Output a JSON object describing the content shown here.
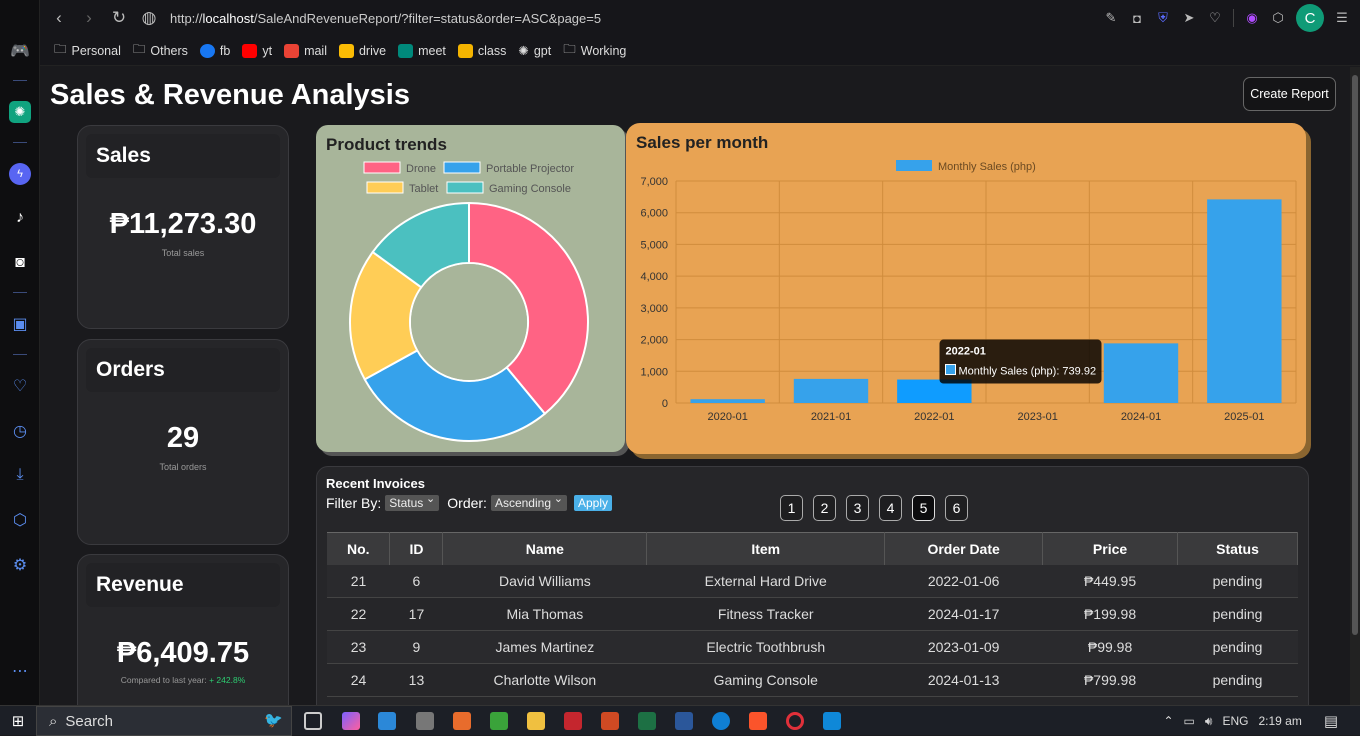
{
  "browser": {
    "url_prefix": "http://",
    "url_host": "localhost",
    "url_path": "/SaleAndRevenueReport/?filter=status&order=ASC&page=5",
    "avatar_letter": "C",
    "bookmarks": [
      "Personal",
      "Others",
      "fb",
      "yt",
      "mail",
      "drive",
      "meet",
      "class",
      "gpt",
      "Working"
    ]
  },
  "page": {
    "title": "Sales & Revenue Analysis",
    "create_report_label": "Create Report"
  },
  "cards": {
    "sales": {
      "title": "Sales",
      "value": "₱11,273.30",
      "sub": "Total sales"
    },
    "orders": {
      "title": "Orders",
      "value": "29",
      "sub": "Total orders"
    },
    "revenue": {
      "title": "Revenue",
      "value": "₱6,409.75",
      "sub_prefix": "Compared to last year: ",
      "sub_change": "+ 242.8%"
    }
  },
  "pie_chart": {
    "title": "Product trends",
    "chart_data": {
      "type": "pie",
      "labels": [
        "Drone",
        "Portable Projector",
        "Tablet",
        "Gaming Console"
      ],
      "values": [
        39,
        28,
        18,
        15
      ],
      "colors": [
        "#ff6384",
        "#36a2eb",
        "#ffcd56",
        "#4bc0c0"
      ]
    }
  },
  "bar_chart": {
    "title": "Sales per month",
    "legend": "Monthly Sales (php)",
    "tooltip": {
      "title": "2022-01",
      "label": "Monthly Sales (php): 739.92"
    },
    "chart_data": {
      "type": "bar",
      "categories": [
        "2020-01",
        "2021-01",
        "2022-01",
        "2023-01",
        "2024-01",
        "2025-01"
      ],
      "series": [
        {
          "name": "Monthly Sales (php)",
          "values": [
            120,
            760,
            739.92,
            0,
            1880,
            6420
          ]
        }
      ],
      "ylim": [
        0,
        7000
      ],
      "yticks": [
        "7,000",
        "6,000",
        "5,000",
        "4,000",
        "3,000",
        "2,000",
        "1,000",
        "0"
      ],
      "bar_color": "#36a2eb"
    }
  },
  "invoices": {
    "title": "Recent Invoices",
    "filter_label": "Filter By:",
    "filter_value": "Status",
    "order_label": "Order:",
    "order_value": "Ascending",
    "apply_label": "Apply",
    "pages": [
      "1",
      "2",
      "3",
      "4",
      "5",
      "6"
    ],
    "active_page": "5",
    "columns": [
      "No.",
      "ID",
      "Name",
      "Item",
      "Order Date",
      "Price",
      "Status"
    ],
    "rows": [
      [
        "21",
        "6",
        "David Williams",
        "External Hard Drive",
        "2022-01-06",
        "₱449.95",
        "pending"
      ],
      [
        "22",
        "17",
        "Mia Thomas",
        "Fitness Tracker",
        "2024-01-17",
        "₱199.98",
        "pending"
      ],
      [
        "23",
        "9",
        "James Martinez",
        "Electric Toothbrush",
        "2023-01-09",
        "₱99.98",
        "pending"
      ],
      [
        "24",
        "13",
        "Charlotte Wilson",
        "Gaming Console",
        "2024-01-13",
        "₱799.98",
        "pending"
      ]
    ]
  },
  "taskbar": {
    "search_placeholder": "Search",
    "language": "ENG",
    "time": "2:19 am"
  }
}
